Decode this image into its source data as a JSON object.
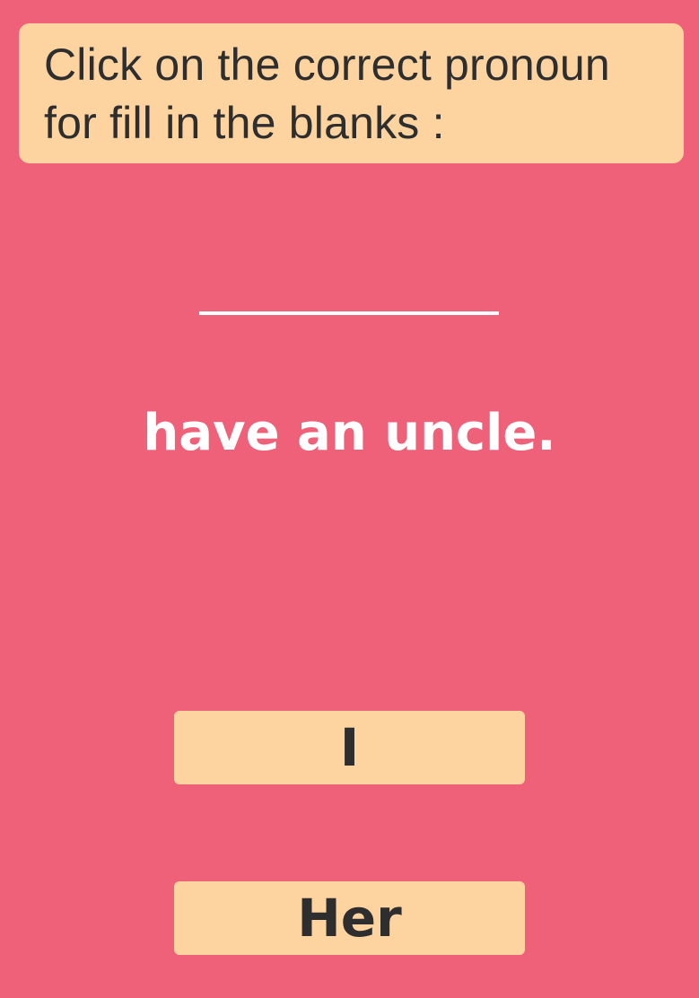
{
  "instruction": {
    "text": "Click on the correct pronoun for fill in the blanks :"
  },
  "question": {
    "sentence": "have an uncle."
  },
  "options": [
    {
      "label": "I"
    },
    {
      "label": "Her"
    }
  ],
  "colors": {
    "background": "#ef6179",
    "panel": "#fdd39f",
    "text_dark": "#2e2e2e",
    "text_light": "#ffffff"
  }
}
